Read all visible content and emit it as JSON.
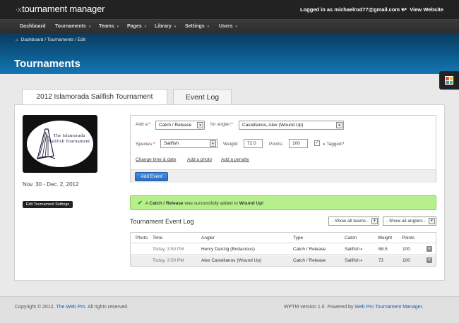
{
  "header": {
    "logo_mark": "∙x",
    "logo_text": "tournament manager",
    "user_info": "Logged in as michaelrod77@gmail.com",
    "user_caret": "▾",
    "view_site_icon": "↗",
    "view_site": "View Website"
  },
  "nav": {
    "caret": "▾",
    "items": [
      "Dashboard",
      "Tournaments",
      "Teams",
      "Pages",
      "Library",
      "Settings",
      "Users"
    ]
  },
  "breadcrumb": {
    "home_icon": "⌂",
    "text": "Dashboard / Tournaments / Edit"
  },
  "page_title": "Tournaments",
  "tabs": [
    "2012 Islamorada Sailfish Tournament",
    "Event Log"
  ],
  "tournament": {
    "logo_text": "The Islamorada Sailfish Tournament",
    "dates": "Nov. 30 - Dec. 2, 2012",
    "settings_button": "Edit Tournament Settings"
  },
  "form": {
    "add_a_label": "Add a:",
    "add_a_value": "Catch / Release",
    "for_angler_label": "for angler:",
    "for_angler_value": "Castellanos, Alex (Wound Up)",
    "species_label": "Species:",
    "species_value": "Sailfish",
    "weight_label": "Weight:",
    "weight_value": "72.0",
    "points_label": "Points:",
    "points_value": "100",
    "tagged_label": "Tagged?",
    "tagged_checked": true,
    "check_mark": "✓",
    "required_mark": "*",
    "select_arrow": "▾",
    "tag_icon": "●",
    "links": [
      "Change time & date",
      "Add a photo",
      "Add a penalty"
    ],
    "add_button": "Add Event"
  },
  "alert": {
    "icon": "✔",
    "prefix": "A ",
    "bold1": "Catch / Release",
    "middle": " was successfully added to ",
    "bold2": "Wound Up!"
  },
  "log": {
    "title": "Tournament Event Log",
    "filter_teams": "- Show all teams -",
    "filter_anglers": "- Show all anglers -",
    "columns": [
      "Photo",
      "Time",
      "Angler",
      "Type",
      "Catch",
      "Weight",
      "Points"
    ],
    "pin_icon": "●",
    "delete_icon": "✕",
    "rows": [
      {
        "time": "Today, 3:50 PM",
        "angler": "Henry Danzig (Bodacious)",
        "type": "Catch / Release",
        "catch": "Sailfish",
        "weight": "68.5",
        "points": "100"
      },
      {
        "time": "Today, 3:50 PM",
        "angler": "Alex Castellanos (Wound Up)",
        "type": "Catch / Release",
        "catch": "Sailfish",
        "weight": "72",
        "points": "100"
      }
    ]
  },
  "footer": {
    "copy_prefix": "Copyright © 2012, ",
    "copy_link": "The Web Pro",
    "copy_suffix": ". All rights reserved.",
    "version_prefix": "WPTM version 1.0. Powered by ",
    "version_link": "Web Pro Tournament Manager",
    "version_suffix": "."
  },
  "colors": {
    "accent": "#1476b5",
    "success": "#b6f08a",
    "button": "#2a6cc4"
  }
}
